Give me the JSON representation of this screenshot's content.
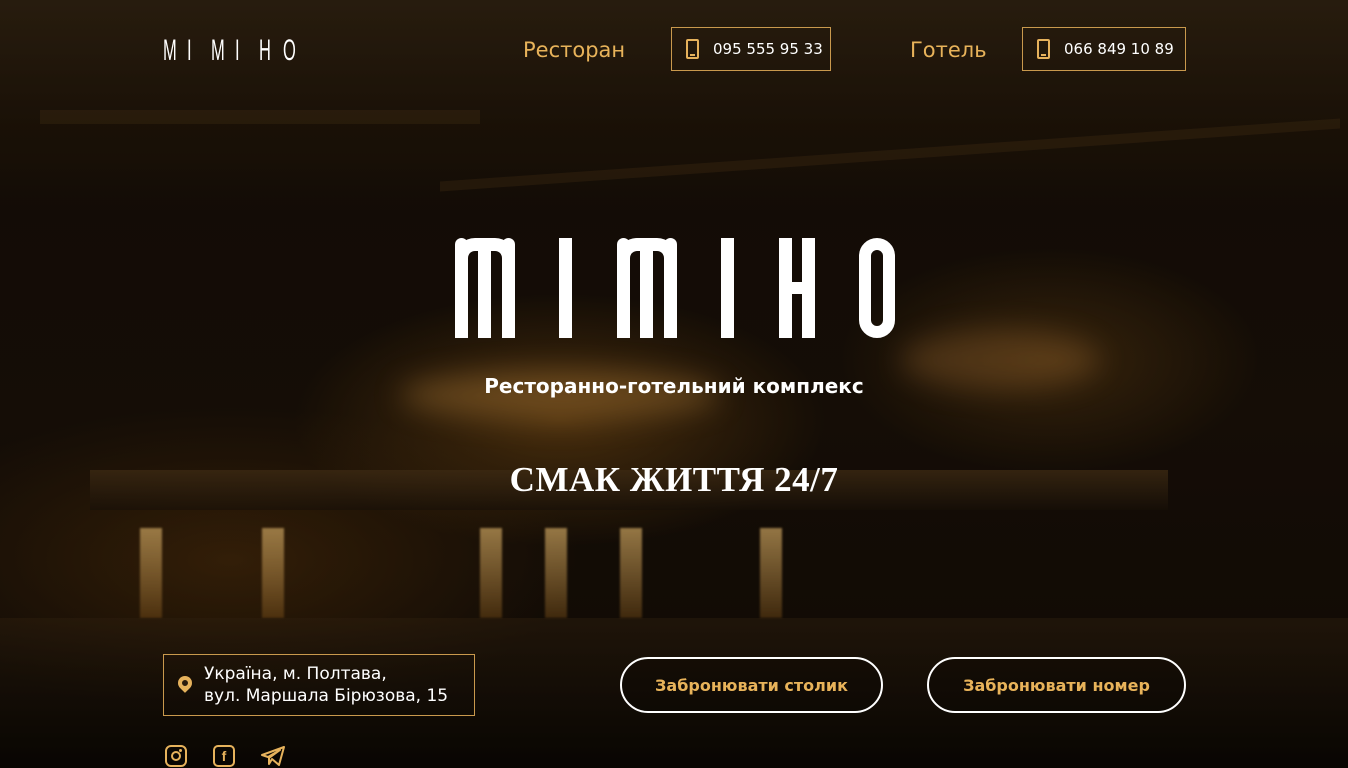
{
  "brand": {
    "logo_letters": [
      "M",
      "I",
      "M",
      "I",
      "H",
      "O"
    ],
    "hero_logo_letters": [
      "M",
      "I",
      "M",
      "I",
      "H",
      "O"
    ]
  },
  "nav": {
    "restaurant_label": "Ресторан",
    "restaurant_phone": "095 555 95 33",
    "hotel_label": "Готель",
    "hotel_phone": "066 849 10 89"
  },
  "hero": {
    "subtitle": "Ресторанно-готельний комплекс",
    "tagline": "СМАК ЖИТТЯ 24/7"
  },
  "address": {
    "line1": "Україна, м. Полтава,",
    "line2": "вул. Маршала Бірюзова, 15"
  },
  "actions": {
    "book_table": "Забронювати столик",
    "book_room": "Забронювати номер"
  },
  "social": {
    "icons": [
      "instagram-icon",
      "facebook-icon",
      "telegram-icon"
    ],
    "facebook_glyph": "f"
  },
  "colors": {
    "accent": "#e8b35a",
    "border": "#c9994d",
    "text": "#ffffff"
  }
}
